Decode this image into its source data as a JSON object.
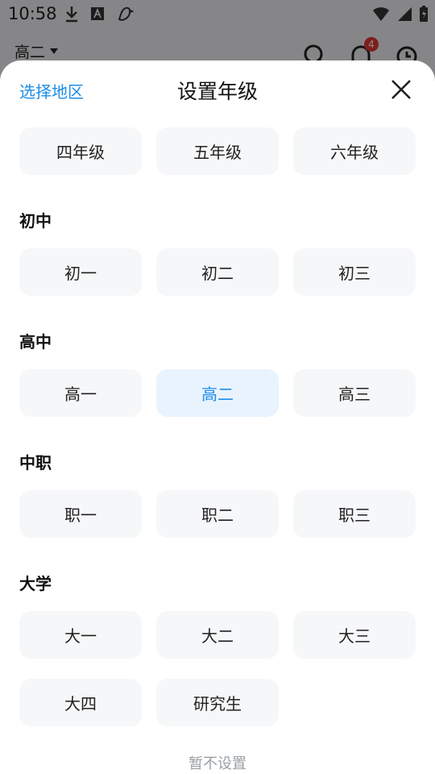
{
  "status_bar": {
    "time": "10:58",
    "left_icons": [
      "download-icon",
      "app-font-icon",
      "bird-icon"
    ],
    "right_icons": [
      "wifi-icon",
      "signal-icon",
      "battery-icon"
    ]
  },
  "app_header": {
    "current_grade": "高二",
    "notification_count": "4",
    "icons": [
      "search-icon",
      "bell-icon",
      "history-icon"
    ]
  },
  "sheet": {
    "region_link": "选择地区",
    "title": "设置年级",
    "close_icon": "close-icon",
    "primary_row": [
      "四年级",
      "五年级",
      "六年级"
    ],
    "sections": [
      {
        "title": "初中",
        "grades": [
          "初一",
          "初二",
          "初三"
        ]
      },
      {
        "title": "高中",
        "grades": [
          "高一",
          "高二",
          "高三"
        ]
      },
      {
        "title": "中职",
        "grades": [
          "职一",
          "职二",
          "职三"
        ]
      },
      {
        "title": "大学",
        "grades": [
          "大一",
          "大二",
          "大三",
          "大四",
          "研究生"
        ]
      }
    ],
    "selected_grade": "高二",
    "skip_link": "暂不设置"
  },
  "colors": {
    "accent": "#1f8de6",
    "selected_bg": "#e8f3fe",
    "button_bg": "#f6f7f9"
  }
}
